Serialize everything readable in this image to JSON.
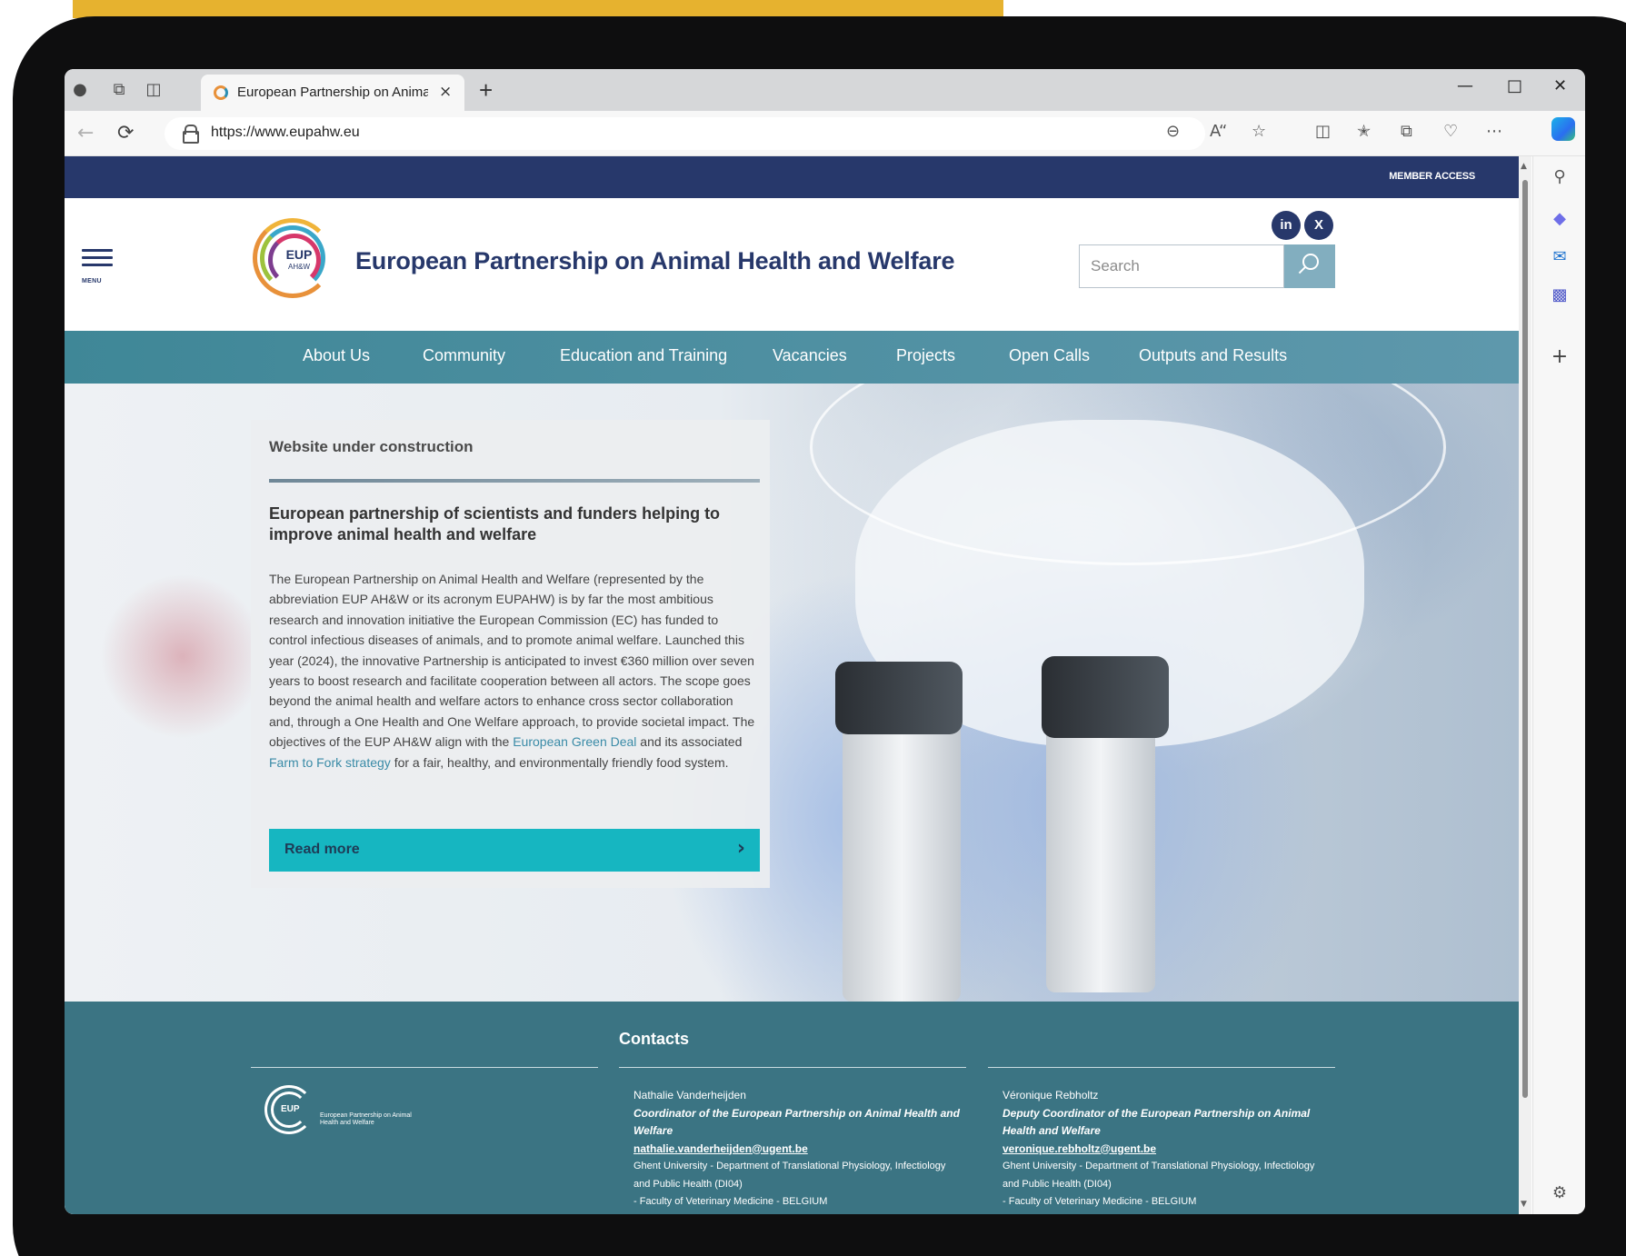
{
  "browser": {
    "tab_title": "European Partnership on Animal Health and Welfare",
    "url": "https://www.eupahw.eu",
    "new_tab_symbol": "+",
    "close_symbol": "×"
  },
  "site": {
    "member_access": "MEMBER ACCESS",
    "menu_label": "MENU",
    "logo_text": "EUP",
    "logo_subtext": "AH&W",
    "title": "European Partnership on Animal Health and Welfare",
    "social": [
      {
        "name": "linkedin",
        "label": "in"
      },
      {
        "name": "x",
        "label": "X"
      }
    ],
    "search_placeholder": "Search",
    "nav": [
      "About Us",
      "Community",
      "Education and Training",
      "Vacancies",
      "Projects",
      "Open Calls",
      "Outputs and Results"
    ]
  },
  "hero_card": {
    "eyebrow": "Website under construction",
    "title": "European partnership of scientists and funders helping to improve animal health and welfare",
    "body_intro": "The European Partnership on Animal Health and Welfare (represented by the abbreviation EUP AH&W or its acronym EUPAHW) is by far the most ambitious research and innovation initiative the European Commission (EC) has funded to control infectious diseases of animals, and to promote animal welfare. Launched this year (2024), the innovative Partnership is anticipated to invest €360 million over seven years to boost research and facilitate cooperation between all actors. The scope goes beyond the animal health and welfare actors to enhance cross sector collaboration and, through a One Health and One Welfare approach, to provide societal impact. The objectives of the EUP AH&W align with the ",
    "link1": "European Green Deal",
    "body_mid": " and its associated ",
    "link2": "Farm to Fork strategy",
    "body_end": " for a fair, healthy, and environmentally friendly food system.",
    "button_label": "Read more",
    "button_icon": "›"
  },
  "footer": {
    "heading": "Contacts",
    "logo_text": "European Partnership on Animal Health and Welfare",
    "contacts": [
      {
        "name": "Nathalie Vanderheijden",
        "role": "Coordinator of the European Partnership on Animal Health and Welfare",
        "email": "nathalie.vanderheijden@ugent.be",
        "affiliation": "Ghent University - Department of Translational Physiology, Infectiology and Public Health (DI04)",
        "faculty": "- Faculty of Veterinary Medicine - BELGIUM"
      },
      {
        "name": "Véronique Rebholtz",
        "role": "Deputy Coordinator of the European Partnership on Animal Health and Welfare",
        "email": "veronique.rebholtz@ugent.be",
        "affiliation": "Ghent University - Department of Translational Physiology, Infectiology and Public Health (DI04)",
        "faculty": "- Faculty of Veterinary Medicine - BELGIUM"
      }
    ]
  },
  "colors": {
    "brand_navy": "#27386b",
    "nav_teal": "#4f8fa3",
    "button_cyan": "#16b6c1",
    "footer_teal": "#3b7483",
    "tablet_yellow": "#e6b22f"
  }
}
